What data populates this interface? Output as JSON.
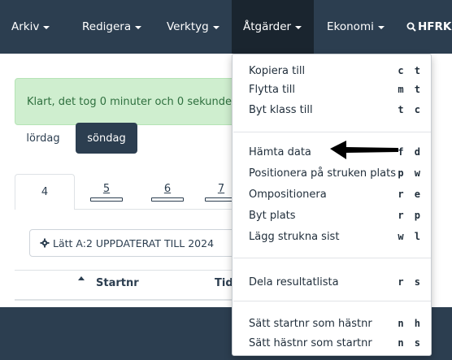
{
  "navbar": {
    "items": [
      {
        "label": "Arkiv"
      },
      {
        "label": "Redigera"
      },
      {
        "label": "Verktyg"
      },
      {
        "label": "Åtgärder",
        "active": true
      },
      {
        "label": "Ekonomi"
      }
    ],
    "search_label": "HFRK"
  },
  "alert": {
    "text": "Klart, det tog 0 minuter och 0 sekunde"
  },
  "days": {
    "inactive": "lördag",
    "active": "söndag"
  },
  "tabs": {
    "active": "4",
    "others": [
      "5",
      "6",
      "7"
    ]
  },
  "toolbar": {
    "button_label": "Lätt A:2 UPPDATERAT TILL 2024"
  },
  "table": {
    "columns": [
      "Startnr",
      "Tid"
    ]
  },
  "dropdown": {
    "items": [
      {
        "label": "Kopiera till",
        "shortcut": "c t"
      },
      {
        "label": "Flytta till",
        "shortcut": "m t"
      },
      {
        "label": "Byt klass till",
        "shortcut": "t c"
      },
      {
        "label": "Hämta data",
        "shortcut": "f d"
      },
      {
        "label": "Positionera på struken plats",
        "shortcut": "p w"
      },
      {
        "label": "Ompositionera",
        "shortcut": "r e"
      },
      {
        "label": "Byt plats",
        "shortcut": "r p"
      },
      {
        "label": "Lägg strukna sist",
        "shortcut": "w l"
      },
      {
        "label": "Dela resultatlista",
        "shortcut": "r s"
      },
      {
        "label": "Sätt startnr som hästnr",
        "shortcut": "n h"
      },
      {
        "label": "Sätt hästnr som startnr",
        "shortcut": "n s"
      }
    ]
  },
  "icons": {
    "search": "search-icon",
    "gear": "gear-icon",
    "arrow": "left-arrow-annotation"
  },
  "colors": {
    "navbar": "#2c3e50",
    "alert_bg": "#cfeecf",
    "alert_text": "#2e6f3e"
  }
}
